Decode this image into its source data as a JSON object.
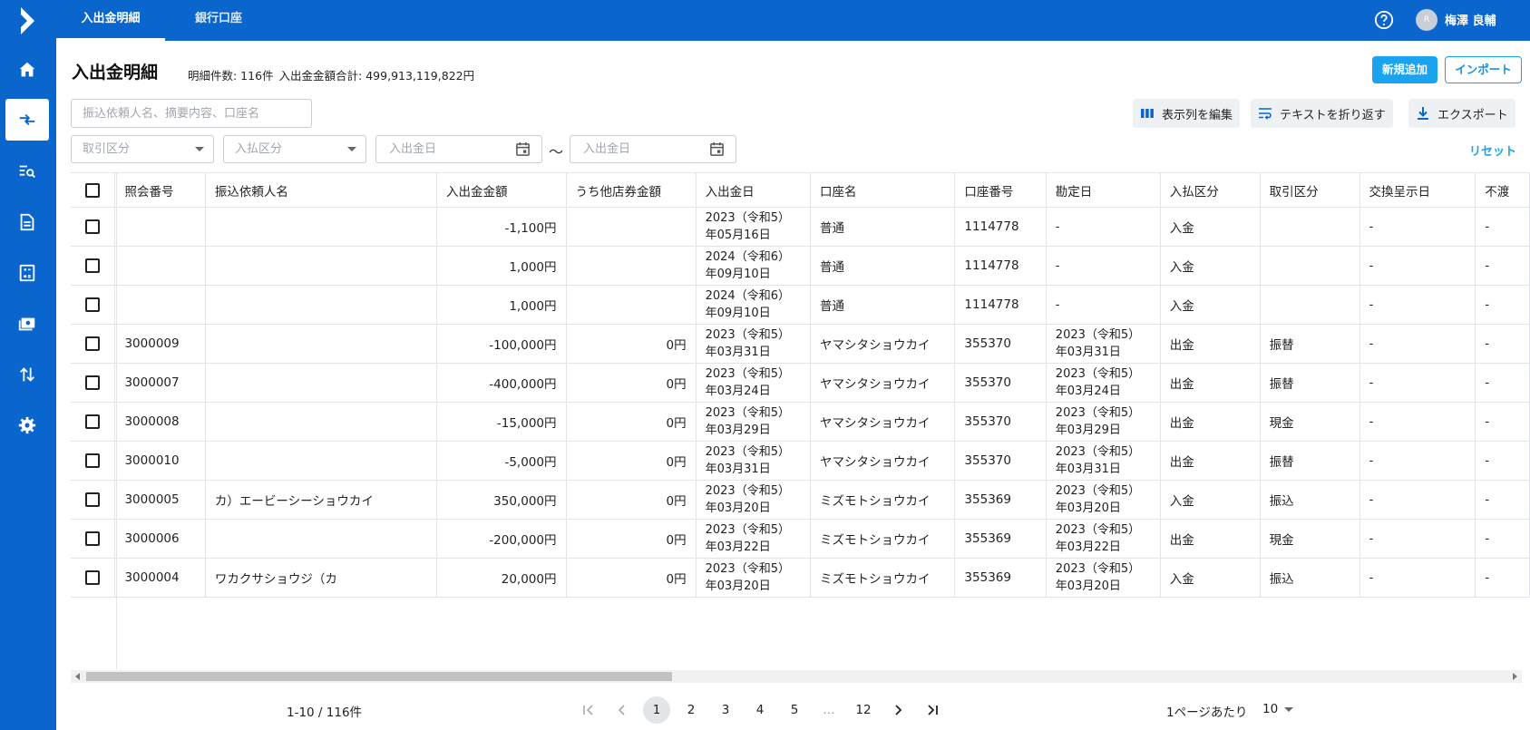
{
  "topbar": {
    "tabs": [
      {
        "label": "入出金明細"
      },
      {
        "label": "銀行口座"
      }
    ],
    "user": {
      "avatar_initial": "R",
      "name": "梅澤 良輔"
    }
  },
  "header": {
    "title": "入出金明細",
    "count_text": "明細件数: 116件",
    "total_text": "入出金金額合計: 499,913,119,822円",
    "new_button": "新規追加",
    "import_button": "インポート"
  },
  "filters": {
    "search_placeholder": "振込依頼人名、摘要内容、口座名",
    "toolbar": {
      "edit_columns": "表示列を編集",
      "wrap_text": "テキストを折り返す",
      "export": "エクスポート"
    },
    "transaction_type": "取引区分",
    "in_out_type": "入払区分",
    "date_from": "入出金日",
    "date_to": "入出金日",
    "tilde": "〜",
    "reset": "リセット"
  },
  "table": {
    "columns": [
      "照会番号",
      "振込依頼人名",
      "入出金金額",
      "うち他店券金額",
      "入出金日",
      "口座名",
      "口座番号",
      "勘定日",
      "入払区分",
      "取引区分",
      "交換呈示日",
      "不渡"
    ],
    "rows": [
      [
        "",
        "",
        "-1,100円",
        "",
        "2023（令和5）年05月16日",
        "普通",
        "1114778",
        "-",
        "入金",
        "",
        "-",
        "-"
      ],
      [
        "",
        "",
        "1,000円",
        "",
        "2024（令和6）年09月10日",
        "普通",
        "1114778",
        "-",
        "入金",
        "",
        "-",
        "-"
      ],
      [
        "",
        "",
        "1,000円",
        "",
        "2024（令和6）年09月10日",
        "普通",
        "1114778",
        "-",
        "入金",
        "",
        "-",
        "-"
      ],
      [
        "3000009",
        "",
        "-100,000円",
        "0円",
        "2023（令和5）年03月31日",
        "ヤマシタショウカイ",
        "355370",
        "2023（令和5）年03月31日",
        "出金",
        "振替",
        "-",
        "-"
      ],
      [
        "3000007",
        "",
        "-400,000円",
        "0円",
        "2023（令和5）年03月24日",
        "ヤマシタショウカイ",
        "355370",
        "2023（令和5）年03月24日",
        "出金",
        "振替",
        "-",
        "-"
      ],
      [
        "3000008",
        "",
        "-15,000円",
        "0円",
        "2023（令和5）年03月29日",
        "ヤマシタショウカイ",
        "355370",
        "2023（令和5）年03月29日",
        "出金",
        "現金",
        "-",
        "-"
      ],
      [
        "3000010",
        "",
        "-5,000円",
        "0円",
        "2023（令和5）年03月31日",
        "ヤマシタショウカイ",
        "355370",
        "2023（令和5）年03月31日",
        "出金",
        "振替",
        "-",
        "-"
      ],
      [
        "3000005",
        "カ）エービーシーショウカイ",
        "350,000円",
        "0円",
        "2023（令和5）年03月20日",
        "ミズモトショウカイ",
        "355369",
        "2023（令和5）年03月20日",
        "入金",
        "振込",
        "-",
        "-"
      ],
      [
        "3000006",
        "",
        "-200,000円",
        "0円",
        "2023（令和5）年03月22日",
        "ミズモトショウカイ",
        "355369",
        "2023（令和5）年03月22日",
        "出金",
        "現金",
        "-",
        "-"
      ],
      [
        "3000004",
        "ワカクサショウジ（カ",
        "20,000円",
        "0円",
        "2023（令和5）年03月20日",
        "ミズモトショウカイ",
        "355369",
        "2023（令和5）年03月20日",
        "入金",
        "振込",
        "-",
        "-"
      ]
    ]
  },
  "pagination": {
    "range": "1-10 / 116件",
    "pages": [
      "1",
      "2",
      "3",
      "4",
      "5",
      "…",
      "12"
    ],
    "current": "1",
    "per_page_label": "1ページあたり",
    "per_page_value": "10"
  }
}
